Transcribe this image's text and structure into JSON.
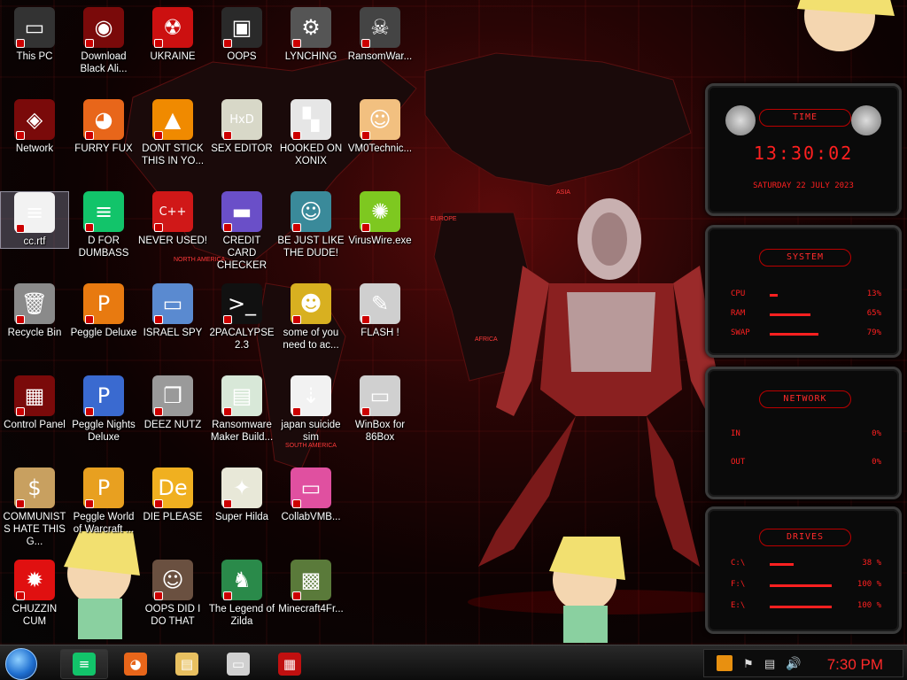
{
  "desktop": {
    "icons": [
      {
        "label": "This PC",
        "icon": "computer-icon",
        "color": "#333333",
        "glyph": "▭"
      },
      {
        "label": "Download Black Ali...",
        "icon": "alien-icon",
        "color": "#7a0a0a",
        "glyph": "◉"
      },
      {
        "label": "UKRAINE",
        "icon": "radiation-icon",
        "color": "#cc1010",
        "glyph": "☢"
      },
      {
        "label": "OOPS",
        "icon": "skull-box-icon",
        "color": "#2a2a2a",
        "glyph": "▣"
      },
      {
        "label": "LYNCHING",
        "icon": "gear-icon",
        "color": "#555555",
        "glyph": "⚙"
      },
      {
        "label": "RansomWar...",
        "icon": "skull-icon",
        "color": "#444444",
        "glyph": "☠"
      },
      {
        "label": "Network",
        "icon": "network-icon",
        "color": "#7a0a0a",
        "glyph": "◈"
      },
      {
        "label": "FURRY FUX",
        "icon": "firefox-icon",
        "color": "#e8661a",
        "glyph": "◕"
      },
      {
        "label": "DONT STICK THIS IN YO...",
        "icon": "vlc-icon",
        "color": "#f08a00",
        "glyph": "▲"
      },
      {
        "label": "SEX EDITOR",
        "icon": "hxd-icon",
        "color": "#d8d8c8",
        "glyph": "HxD"
      },
      {
        "label": "HOOKED ON XONIX",
        "icon": "xonix-icon",
        "color": "#e6e6e6",
        "glyph": "▚"
      },
      {
        "label": "VM0Technic...",
        "icon": "doctor-icon",
        "color": "#f2c080",
        "glyph": "☺"
      },
      {
        "label": "cc.rtf",
        "icon": "document-icon",
        "color": "#f2f2f2",
        "glyph": "≡"
      },
      {
        "label": "D FOR DUMBASS",
        "icon": "chat-icon",
        "color": "#12c46a",
        "glyph": "≡"
      },
      {
        "label": "NEVER USED!",
        "icon": "devcpp-icon",
        "color": "#d01818",
        "glyph": "C++"
      },
      {
        "label": "CREDIT CARD CHECKER",
        "icon": "credit-card-icon",
        "color": "#6a4fc8",
        "glyph": "▬"
      },
      {
        "label": "BE JUST LIKE THE DUDE!",
        "icon": "dude-icon",
        "color": "#3a8a9a",
        "glyph": "☺"
      },
      {
        "label": "VirusWire.exe",
        "icon": "lime-icon",
        "color": "#7ec820",
        "glyph": "✺"
      },
      {
        "label": "Recycle Bin",
        "icon": "recycle-bin-icon",
        "color": "#8a8a8a",
        "glyph": "🗑"
      },
      {
        "label": "Peggle Deluxe",
        "icon": "peggle-icon",
        "color": "#e87a10",
        "glyph": "P"
      },
      {
        "label": "ISRAEL SPY",
        "icon": "network-computers-icon",
        "color": "#5a8ad0",
        "glyph": "▭"
      },
      {
        "label": "2PACALYPSE 2.3",
        "icon": "terminal-icon",
        "color": "#111111",
        "glyph": ">_"
      },
      {
        "label": "some of you need to ac...",
        "icon": "beaver-icon",
        "color": "#d8b020",
        "glyph": "☻"
      },
      {
        "label": "FLASH !",
        "icon": "flash-icon",
        "color": "#cfcfcf",
        "glyph": "✎"
      },
      {
        "label": "Control Panel",
        "icon": "control-panel-icon",
        "color": "#7a0a0a",
        "glyph": "▦"
      },
      {
        "label": "Peggle Nights Deluxe",
        "icon": "peggle-nights-icon",
        "color": "#3a6ad0",
        "glyph": "P"
      },
      {
        "label": "DEEZ NUTZ",
        "icon": "windows-stack-icon",
        "color": "#9a9a9a",
        "glyph": "❐"
      },
      {
        "label": "Ransomware Maker Build...",
        "icon": "window-app-icon",
        "color": "#d8e8d8",
        "glyph": "▤"
      },
      {
        "label": "japan suicide sim",
        "icon": "file-icon",
        "color": "#f2f2f2",
        "glyph": "⇣"
      },
      {
        "label": "WinBox for 86Box",
        "icon": "winbox-icon",
        "color": "#d0d0d0",
        "glyph": "▭"
      },
      {
        "label": "COMMUNISTS HATE THIS G...",
        "icon": "money-bag-icon",
        "color": "#c8a060",
        "glyph": "$"
      },
      {
        "label": "Peggle World of Warcraft ...",
        "icon": "peggle-wow-icon",
        "color": "#e8a020",
        "glyph": "P"
      },
      {
        "label": "DIE PLEASE",
        "icon": "de-icon",
        "color": "#f0b020",
        "glyph": "De"
      },
      {
        "label": "Super Hilda",
        "icon": "hilda-icon",
        "color": "#e8e8d8",
        "glyph": "✦"
      },
      {
        "label": "CollabVMB...",
        "icon": "monitor-icon",
        "color": "#e050a0",
        "glyph": "▭"
      },
      {
        "label": "CHUZZIN CUM",
        "icon": "chuzzle-icon",
        "color": "#e01010",
        "glyph": "✹"
      },
      {
        "label": "OOPS DID I DO THAT",
        "icon": "portrait-icon",
        "color": "#6a5040",
        "glyph": "☺"
      },
      {
        "label": "The Legend of Zilda",
        "icon": "link-sprite-icon",
        "color": "#2a8a4a",
        "glyph": "♞"
      },
      {
        "label": "Minecraft4Fr...",
        "icon": "minecraft-block-icon",
        "color": "#5a7a3a",
        "glyph": "▩"
      }
    ]
  },
  "wallpaper": {
    "map_labels": {
      "north_america": "NORTH AMERICA",
      "south_america": "SOUTH AMERICA",
      "europe": "EUROPE",
      "africa": "AFRICA",
      "asia": "ASIA"
    }
  },
  "gadgets": {
    "time": {
      "title": "TIME",
      "clock": "13:30:02",
      "date": "SATURDAY 22 JULY 2023"
    },
    "system": {
      "title": "SYSTEM",
      "rows": [
        {
          "key": "CPU",
          "value": "13%",
          "level": 0.13
        },
        {
          "key": "RAM",
          "value": "65%",
          "level": 0.65
        },
        {
          "key": "SWAP",
          "value": "79%",
          "level": 0.79
        }
      ]
    },
    "network": {
      "title": "NETWORK",
      "rows": [
        {
          "key": "IN",
          "value": "0%"
        },
        {
          "key": "OUT",
          "value": "0%"
        }
      ]
    },
    "drives": {
      "title": "DRIVES",
      "rows": [
        {
          "key": "C:\\",
          "value": "38 %",
          "level": 0.38
        },
        {
          "key": "F:\\",
          "value": "100 %",
          "level": 1.0
        },
        {
          "key": "E:\\",
          "value": "100 %",
          "level": 1.0
        }
      ]
    }
  },
  "taskbar": {
    "apps": [
      {
        "name": "chat-app",
        "glyph": "≡",
        "color": "#12c46a",
        "active": true
      },
      {
        "name": "firefox",
        "glyph": "◕",
        "color": "#e8661a",
        "active": false
      },
      {
        "name": "file-explorer",
        "glyph": "▤",
        "color": "#e8c060",
        "active": false
      },
      {
        "name": "winbox",
        "glyph": "▭",
        "color": "#d0d0d0",
        "active": false
      },
      {
        "name": "control-panel",
        "glyph": "▦",
        "color": "#c01010",
        "active": false
      }
    ],
    "clock": "7:30 PM"
  },
  "colors": {
    "accent": "#ff2020",
    "selection": "#7878a0"
  }
}
